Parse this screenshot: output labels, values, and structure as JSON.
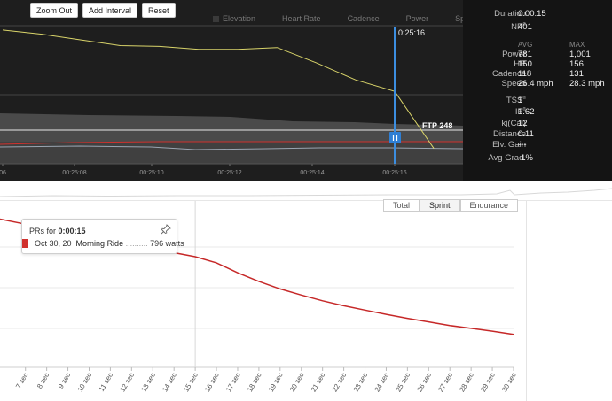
{
  "toolbar": {
    "zoom_out": "Zoom Out",
    "add_interval": "Add Interval",
    "reset": "Reset"
  },
  "legend": [
    {
      "label": "Elevation",
      "color": "#3a3a3a",
      "kind": "box"
    },
    {
      "label": "Heart Rate",
      "color": "#d0312d",
      "kind": "line"
    },
    {
      "label": "Cadence",
      "color": "#9aa4b0",
      "kind": "line"
    },
    {
      "label": "Power",
      "color": "#d9d46a",
      "kind": "line"
    },
    {
      "label": "Speed",
      "color": "#555555",
      "kind": "line"
    }
  ],
  "top_chart": {
    "cursor_time": "0:25:16",
    "ftp_label": "FTP 248",
    "x_ticks": [
      "06",
      "00:25:08",
      "00:25:10",
      "00:25:12",
      "00:25:14",
      "00:25:16"
    ],
    "power": [
      [
        "0:25:06",
        1001
      ],
      [
        "0:25:07",
        990
      ],
      [
        "0:25:08",
        975
      ],
      [
        "0:25:09",
        960
      ],
      [
        "0:25:10",
        958
      ],
      [
        "0:25:11",
        950
      ],
      [
        "0:25:12",
        950
      ],
      [
        "0:25:13",
        955
      ],
      [
        "0:25:14",
        915
      ],
      [
        "0:25:15",
        870
      ],
      [
        "0:25:16",
        840
      ],
      [
        "0:25:17",
        690
      ]
    ]
  },
  "stats": {
    "duration_label": "Duration",
    "duration": "0:00:15",
    "np_label": "NP",
    "np_sup": "®",
    "np": "401",
    "avg_label": "AVG",
    "max_label": "MAX",
    "rows": [
      {
        "label": "Power",
        "avg": "781",
        "max": "1,001"
      },
      {
        "label": "HR",
        "avg": "150",
        "max": "156"
      },
      {
        "label": "Cadence",
        "avg": "118",
        "max": "131"
      },
      {
        "label": "Speed",
        "avg": "26.4 mph",
        "max": "28.3 mph"
      }
    ],
    "tss_label": "TSS",
    "tss_sup": "®",
    "tss": "1",
    "if_label": "IF",
    "if_sup": "®",
    "if": "1.62",
    "kj_label": "kj(Cal)",
    "kj": "12",
    "distance_label": "Distance",
    "distance": "0.11",
    "elv_label": "Elv. Gain",
    "elv": "---",
    "grade_label": "Avg Grad.",
    "grade": "-1%"
  },
  "tabs": [
    {
      "label": "Total",
      "active": false
    },
    {
      "label": "Sprint",
      "active": true
    },
    {
      "label": "Endurance",
      "active": false
    }
  ],
  "tooltip": {
    "prefix": "PRs for ",
    "duration": "0:00:15",
    "date": "Oct 30, 20",
    "ride": "Morning Ride",
    "dots": "..........",
    "value": "796 watts"
  },
  "chart_data": {
    "type": "line",
    "x": [
      "7 sec",
      "8 sec",
      "9 sec",
      "10 sec",
      "11 sec",
      "12 sec",
      "13 sec",
      "14 sec",
      "15 sec",
      "16 sec",
      "17 sec",
      "18 sec",
      "19 sec",
      "20 sec",
      "21 sec",
      "22 sec",
      "23 sec",
      "24 sec",
      "25 sec",
      "26 sec",
      "27 sec",
      "28 sec",
      "29 sec",
      "30 sec"
    ],
    "series": [
      {
        "values": [
          880,
          864,
          850,
          842,
          830,
          818,
          810,
          800,
          789,
          772,
          744,
          720,
          699,
          682,
          666,
          652,
          640,
          628,
          617,
          607,
          597,
          589,
          581,
          572
        ],
        "color": "#c62828"
      }
    ],
    "x_range_sec": [
      5.8,
      30
    ],
    "y_range": [
      480,
      920
    ],
    "highlight_x": "15 sec"
  }
}
